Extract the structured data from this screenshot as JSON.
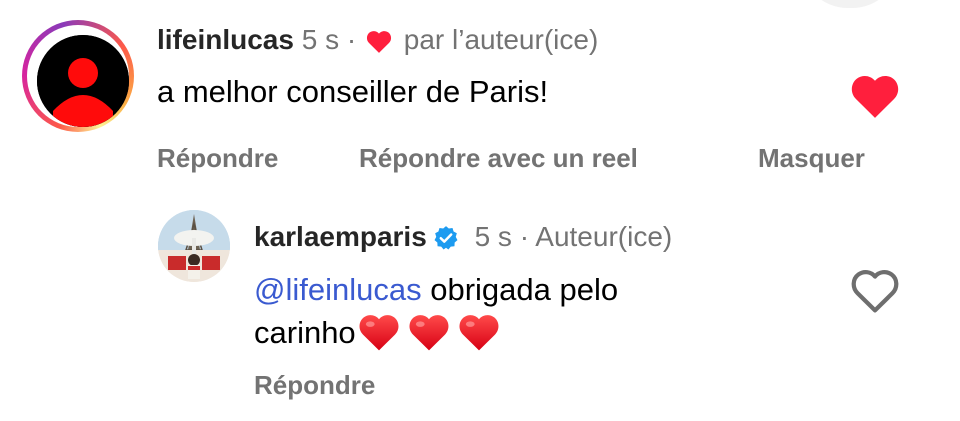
{
  "comment": {
    "username": "lifeinlucas",
    "time": "5 s",
    "separator": "·",
    "liked_by_author": "par l’auteur(ice)",
    "text": "a melhor conseiller de Paris!",
    "actions": {
      "reply": "Répondre",
      "reply_reel": "Répondre avec un reel",
      "hide": "Masquer"
    },
    "liked": true
  },
  "reply": {
    "username": "karlaemparis",
    "verified": true,
    "time": "5 s",
    "separator": "·",
    "role": "Auteur(ice)",
    "mention": "@lifeinlucas",
    "text_line1": "obrigada pelo",
    "text_line2": "carinho",
    "emoji_hearts": 3,
    "actions": {
      "reply": "Répondre"
    },
    "liked": false
  },
  "icons": {
    "author_like": "small-red-heart-icon",
    "like_filled": "heart-filled-icon",
    "like_outline": "heart-outline-icon",
    "verified": "verified-badge-icon"
  },
  "colors": {
    "like_red": "#ff1f3d",
    "mention_blue": "#3a5ad0",
    "meta_gray": "#737373",
    "verified_blue": "#1d9bf0"
  }
}
